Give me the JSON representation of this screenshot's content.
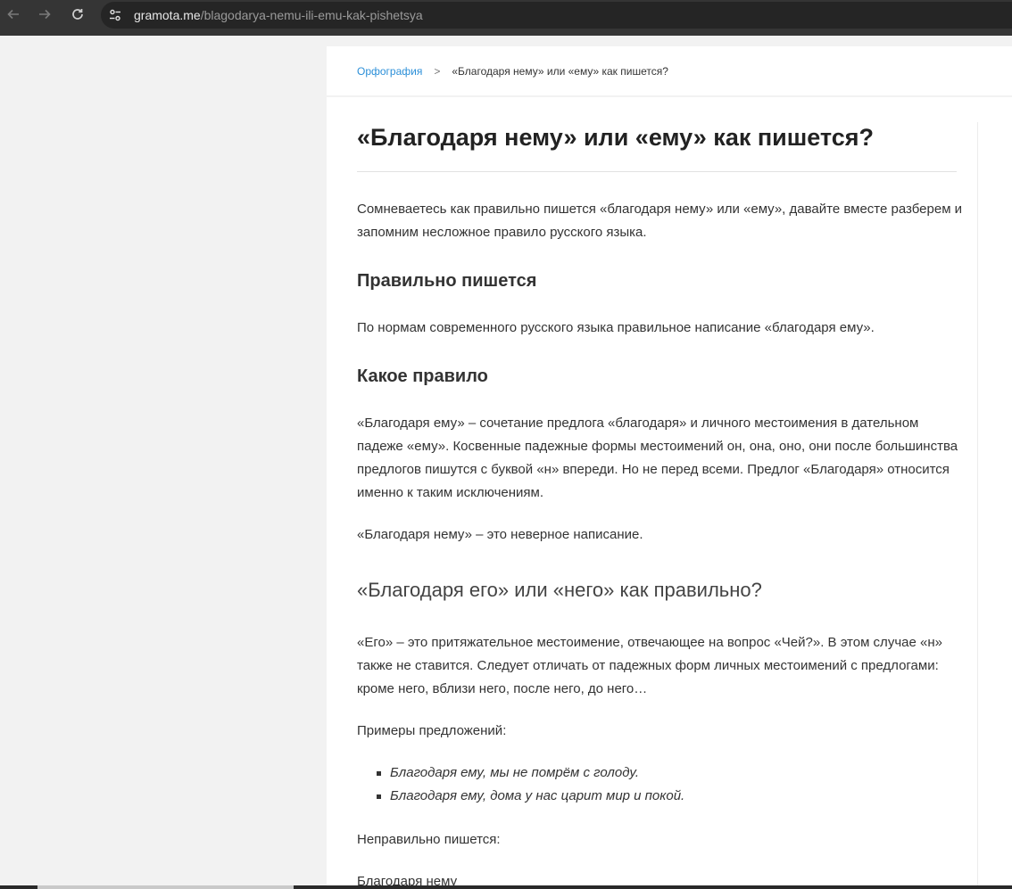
{
  "browser": {
    "url_host": "gramota.me",
    "url_path": "/blagodarya-nemu-ili-emu-kak-pishetsya"
  },
  "breadcrumb": {
    "category": "Орфография",
    "separator": ">",
    "current": "«Благодаря нему» или «ему» как пишется?"
  },
  "article": {
    "title": "«Благодаря нему» или «ему» как пишется?",
    "intro": "Сомневаетесь как правильно пишется «благодаря нему» или «ему», давайте вместе разберем и запомним несложное правило русского языка.",
    "h_correct": "Правильно пишется",
    "p_correct": "По нормам современного русского языка правильное написание «благодаря ему».",
    "h_rule": "Какое правило",
    "p_rule": "«Благодаря ему» – сочетание предлога «благодаря» и личного местоимения в дательном падеже «ему». Косвенные падежные формы местоимений он, она, оно, они после большинства предлогов пишутся с буквой «н» впереди. Но не перед всеми. Предлог «Благодаря» относится именно к таким исключениям.",
    "p_wrong_form": "«Благодаря нему» – это неверное написание.",
    "h_ego": "«Благодаря его» или «него» как правильно?",
    "p_ego": "«Его» – это притяжательное местоимение, отвечающее на вопрос «Чей?». В этом случае «н» также не ставится. Следует отличать от падежных форм личных местоимений с предлогами: кроме него, вблизи него, после него, до него…",
    "examples_label": "Примеры предложений:",
    "examples": [
      "Благодаря ему, мы не помрём с голоду.",
      "Благодаря ему, дома у нас царит мир и покой."
    ],
    "wrong_label": "Неправильно пишется:",
    "wrong_value": "Благодаря нему"
  }
}
